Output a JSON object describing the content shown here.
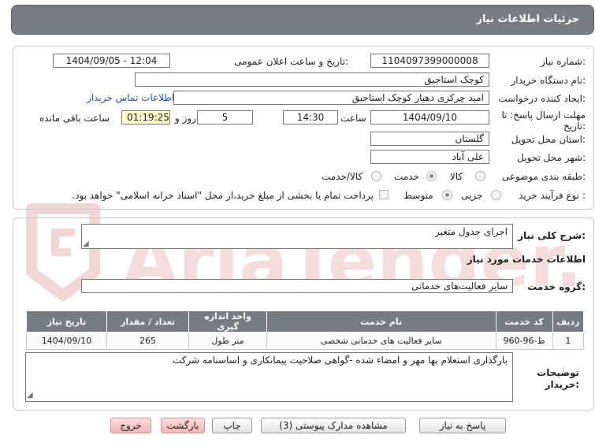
{
  "header": {
    "title": "جزئیات اطلاعات نیاز"
  },
  "info": {
    "need_number_label": "شماره نیاز:",
    "need_number": "1104097399000008",
    "announce_label": "تاریخ و ساعت اعلان عمومی:",
    "announce_value": "1404/09/05 - 12:04",
    "buyer_org_label": "نام دستگاه خریدار:",
    "buyer_org": "کوچک استاجیق",
    "creator_label": "ایجاد کننده درخواست:",
    "creator": "امید چرکزی دهیار کوچک استاجیق",
    "contact_link": "اطلاعات تماس خریدار",
    "deadline_label_1": "مهلت ارسال پاسخ: تا",
    "deadline_label_2": "تاریخ:",
    "deadline_date": "1404/09/10",
    "time_label": "ساعت",
    "deadline_time": "14:30",
    "days_value": "5",
    "days_label": "روز و",
    "remaining_time": "01:19:25",
    "remaining_label": "ساعت باقی مانده",
    "province_label": "استان محل تحویل:",
    "province": "گلستان",
    "city_label": "شهر محل تحویل:",
    "city": "علی آباد",
    "category_label": "طبقه بندی موضوعی:",
    "category_options": [
      "کالا",
      "خدمت",
      "کالا/خدمت"
    ],
    "category_selected": "خدمت",
    "process_label": "نوع فرآیند خرید :",
    "process_options": [
      "جزیی",
      "متوسط"
    ],
    "process_selected": "متوسط",
    "payment_note": "پرداخت تمام یا بخشی از مبلغ خرید،از محل \"اسناد خزانه اسلامی\" خواهد بود."
  },
  "summary": {
    "label": "شرح کلی نیاز:",
    "value": "اجرای جدول متغیر"
  },
  "services": {
    "section_title": "اطلاعات خدمات مورد نیاز",
    "group_label": "گروه خدمت:",
    "group_value": "سایر فعالیت‌های خدماتی",
    "table": {
      "headers": [
        "ردیف",
        "کد خدمت",
        "نام خدمت",
        "واحد اندازه گیری",
        "تعداد / مقدار",
        "تاریخ نیاز"
      ],
      "rows": [
        [
          "1",
          "ط-96-960",
          "سایر فعالیت های خدماتی شخصی",
          "متر طول",
          "265",
          "1404/09/10"
        ]
      ]
    }
  },
  "buyer_notes": {
    "label_1": "توضیحات",
    "label_2": "خریدار:",
    "value": "بارگذاری استعلام بها مهر و امضاء شده -گواهی صلاحیت پیمانکاری و اساسنامه شرکت"
  },
  "buttons": {
    "reply": "پاسخ به نیاز",
    "view_docs": "مشاهده مدارک پیوستی (3)",
    "print": "چاپ",
    "back": "بازگشت",
    "exit": "خروج"
  },
  "watermark": {
    "text": "AriaTender.neT"
  },
  "colors": {
    "header_bg": "#777b82",
    "time_bg": "#fffac8",
    "link": "#1a55c8",
    "watermark": "#f2d6d6"
  }
}
